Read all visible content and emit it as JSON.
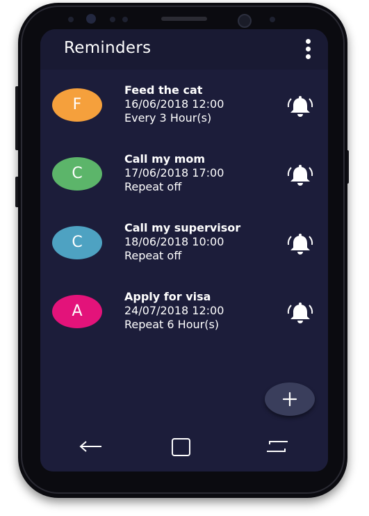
{
  "app": {
    "title": "Reminders"
  },
  "reminders": [
    {
      "initial": "F",
      "color": "#f5a03c",
      "title": "Feed the cat",
      "datetime": "16/06/2018  12:00",
      "repeat": "Every 3 Hour(s)",
      "icon": "alarm-bell-icon"
    },
    {
      "initial": "C",
      "color": "#5cb56a",
      "title": "Call my mom",
      "datetime": "17/06/2018  17:00",
      "repeat": "Repeat off",
      "icon": "alarm-bell-icon"
    },
    {
      "initial": "C",
      "color": "#4ea2c2",
      "title": "Call my supervisor",
      "datetime": "18/06/2018  10:00",
      "repeat": "Repeat off",
      "icon": "alarm-bell-icon"
    },
    {
      "initial": "A",
      "color": "#e3137a",
      "title": "Apply for visa",
      "datetime": "24/07/2018  12:00",
      "repeat": "Repeat 6 Hour(s)",
      "icon": "alarm-bell-icon"
    }
  ],
  "icons": {
    "menu": "more-vert-icon",
    "fab": "plus-icon",
    "nav_back": "back-arrow-icon",
    "nav_home": "home-square-icon",
    "nav_recent": "recent-apps-icon"
  },
  "colors": {
    "screen_bg": "#1c1d3a",
    "appbar_bg": "#191a33",
    "fab_bg": "#3a3e5c"
  }
}
